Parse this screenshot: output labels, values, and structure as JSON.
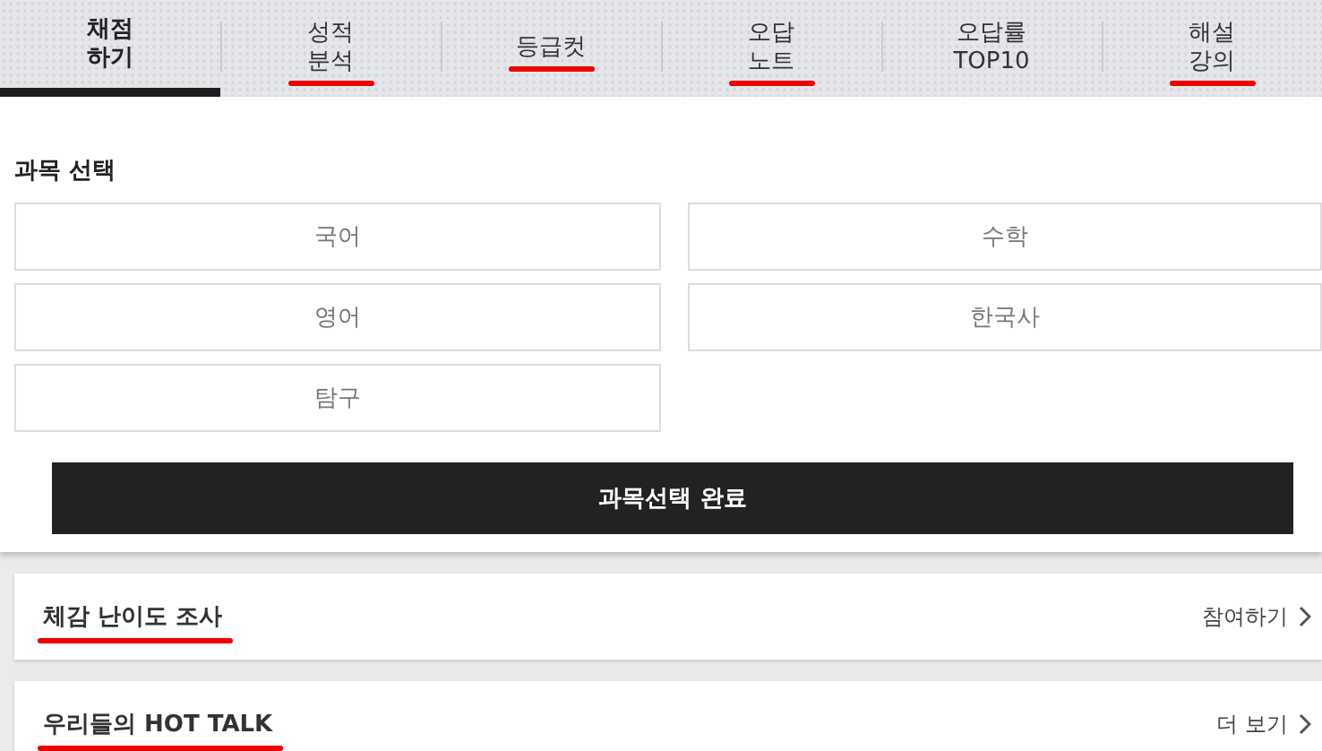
{
  "tabs": [
    {
      "label": "채점\n하기",
      "selected": true,
      "marked": false
    },
    {
      "label": "성적\n분석",
      "selected": false,
      "marked": true
    },
    {
      "label": "등급컷",
      "selected": false,
      "marked": true
    },
    {
      "label": "오답\n노트",
      "selected": false,
      "marked": true
    },
    {
      "label": "오답률\nTOP10",
      "selected": false,
      "marked": false
    },
    {
      "label": "해설\n강의",
      "selected": false,
      "marked": true
    }
  ],
  "subject_select": {
    "title": "과목 선택",
    "subjects": [
      {
        "label": "국어",
        "selected": false
      },
      {
        "label": "수학",
        "selected": false
      },
      {
        "label": "영어",
        "selected": false
      },
      {
        "label": "한국사",
        "selected": false
      },
      {
        "label": "탐구",
        "selected": false
      }
    ],
    "submit": "과목선택 완료"
  },
  "sections": [
    {
      "title": "체감 난이도 조사",
      "action": "참여하기",
      "marked": true
    },
    {
      "title": "우리들의 HOT TALK",
      "action": "더 보기",
      "marked": true
    }
  ]
}
